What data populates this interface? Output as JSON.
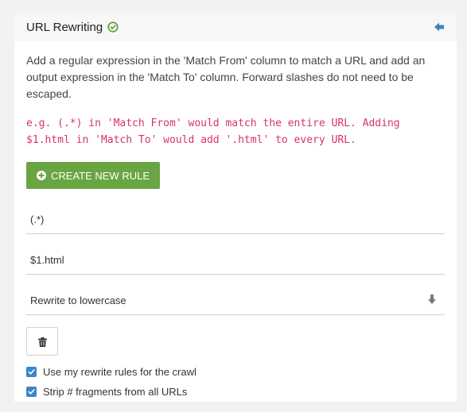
{
  "header": {
    "title": "URL Rewriting",
    "status_icon": "check-circle-icon",
    "back_icon": "arrow-left-icon",
    "colors": {
      "status": "#6aa543",
      "back": "#3a86c8"
    }
  },
  "description": "Add a regular expression in the 'Match From' column to match a URL and add an output expression in the 'Match To' column. Forward slashes do not need to be escaped.",
  "example": "e.g. (.*) in 'Match From' would match the entire URL. Adding $1.html in 'Match To' would add '.html' to every URL.",
  "create_button": {
    "label": "CREATE NEW RULE",
    "icon": "plus-circle-icon",
    "color": "#6aa543"
  },
  "rule": {
    "match_from": "(.*)",
    "match_to": "$1.html",
    "rewrite_option": "Rewrite to lowercase",
    "dropdown_icon": "arrow-down-icon",
    "delete_icon": "trash-icon"
  },
  "options": [
    {
      "label": "Use my rewrite rules for the crawl",
      "checked": true
    },
    {
      "label": "Strip # fragments from all URLs",
      "checked": true
    }
  ],
  "accent_color": "#3a86c8",
  "example_color": "#d6336c"
}
